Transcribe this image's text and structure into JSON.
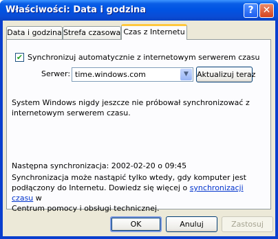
{
  "window": {
    "title": "Właściwości: Data i godzina"
  },
  "tabs": [
    {
      "label": "Data i godzina"
    },
    {
      "label": "Strefa czasowa"
    },
    {
      "label": "Czas z Internetu"
    }
  ],
  "internet_time": {
    "sync_checkbox_label": "Synchronizuj automatycznie z internetowym serwerem czasu",
    "sync_checked": true,
    "server_label": "Serwer:",
    "server_value": "time.windows.com",
    "update_now_label": "Aktualizuj teraz",
    "status_line1": "System Windows nigdy jeszcze nie próbował synchronizować z",
    "status_line2": "internetowym serwerem czasu.",
    "next_sync": "Następna synchronizacja: 2002-02-20 o 09:45",
    "info_line1": "Synchronizacja może nastąpić tylko wtedy, gdy komputer jest",
    "info_line2_before": "podłączony do Internetu. Dowiedz się więcej o ",
    "info_link": "synchronizacji czasu",
    "info_line2_after": " w",
    "info_line3": "Centrum pomocy i obsługi technicznej."
  },
  "buttons": {
    "ok": "OK",
    "cancel": "Anuluj",
    "apply": "Zastosuj"
  },
  "colors": {
    "titlebar": "#0054e3",
    "dialog_bg": "#ece9d8",
    "active_tab_accent": "#ffc83c",
    "link": "#0033cc"
  }
}
